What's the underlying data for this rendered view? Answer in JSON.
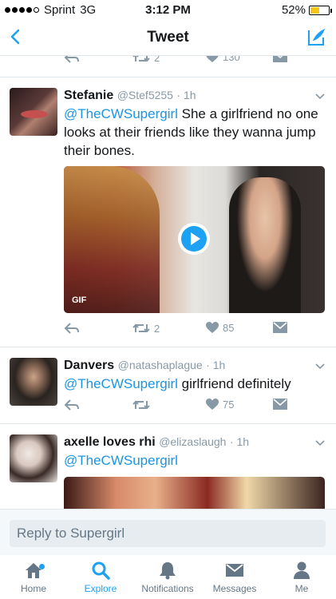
{
  "status_bar": {
    "carrier": "Sprint",
    "network": "3G",
    "time": "3:12 PM",
    "battery_percent": "52%",
    "battery_level": 0.52,
    "signal_bars_filled": 4,
    "signal_bars_total": 5
  },
  "nav": {
    "title": "Tweet",
    "back_icon": "chevron-left-icon",
    "compose_icon": "compose-icon"
  },
  "previous_tweet_actions": {
    "retweets": "2",
    "likes": "130"
  },
  "tweets": [
    {
      "name": "Stefanie",
      "handle": "@Stef5255",
      "time": "· 1h",
      "mention": "@TheCWSupergirl",
      "text": "She a girlfriend no one looks at their friends like they wanna jump their bones.",
      "media_badge": "GIF",
      "retweets": "2",
      "likes": "85"
    },
    {
      "name": "Danvers",
      "handle": "@natashaplague",
      "time": "· 1h",
      "mention": "@TheCWSupergirl",
      "text": "girlfriend definitely",
      "retweets": "",
      "likes": "75"
    },
    {
      "name": "axelle loves rhi",
      "handle": "@elizaslaugh",
      "time": "· 1h",
      "mention": "@TheCWSupergirl",
      "text": ""
    }
  ],
  "reply": {
    "placeholder": "Reply to Supergirl"
  },
  "tabs": [
    {
      "label": "Home",
      "icon": "home-icon"
    },
    {
      "label": "Explore",
      "icon": "search-icon"
    },
    {
      "label": "Notifications",
      "icon": "bell-icon"
    },
    {
      "label": "Messages",
      "icon": "envelope-icon"
    },
    {
      "label": "Me",
      "icon": "person-icon"
    }
  ],
  "colors": {
    "accent": "#1da1f2",
    "mention": "#1b95e0",
    "muted": "#8899a6",
    "divider": "#e1e8ed"
  }
}
